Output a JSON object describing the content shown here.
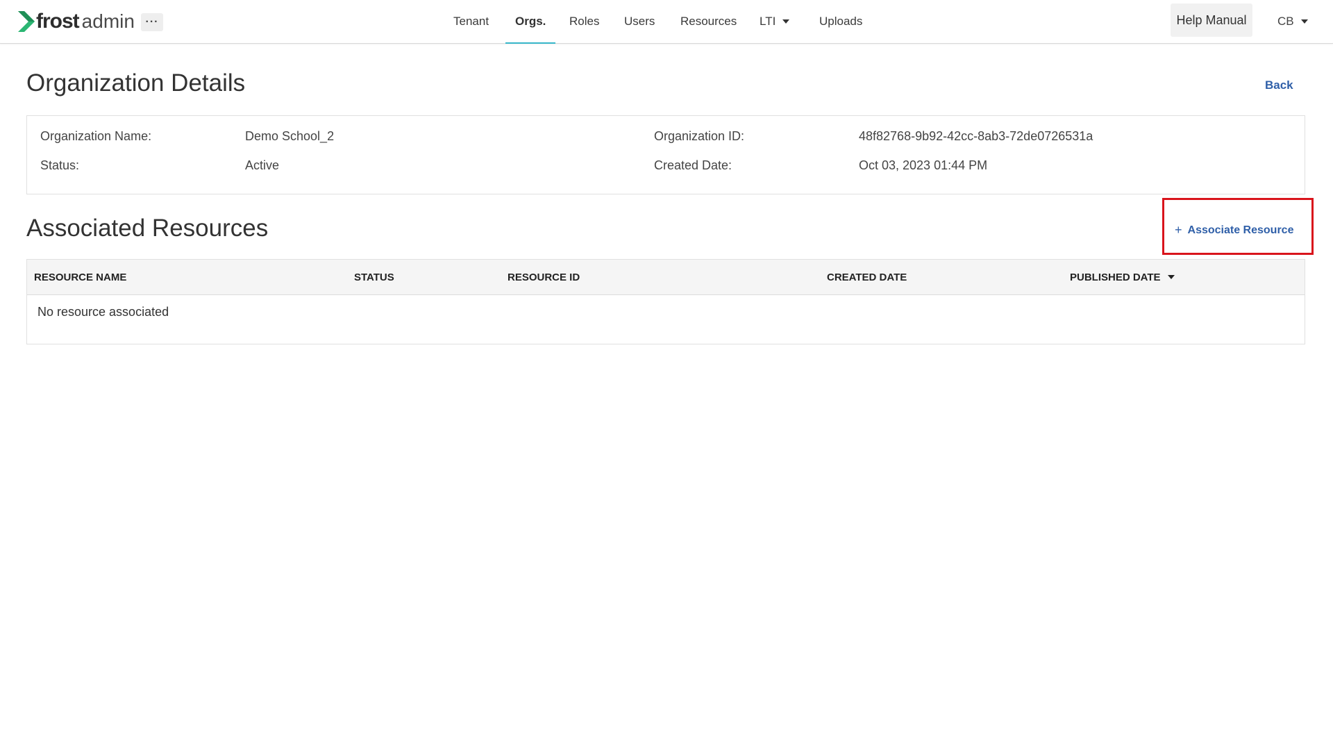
{
  "app": {
    "brand": "frost",
    "suffix": "admin",
    "more_label": "···"
  },
  "nav": {
    "items": [
      {
        "label": "Tenant"
      },
      {
        "label": "Orgs."
      },
      {
        "label": "Roles"
      },
      {
        "label": "Users"
      },
      {
        "label": "Resources"
      },
      {
        "label": "LTI"
      },
      {
        "label": "Uploads"
      }
    ],
    "active": "Orgs.",
    "help_label": "Help Manual",
    "user_initials": "CB"
  },
  "details": {
    "title": "Organization Details",
    "back_label": "Back",
    "fields": {
      "name_label": "Organization Name:",
      "name_value": "Demo School_2",
      "status_label": "Status:",
      "status_value": "Active",
      "id_label": "Organization ID:",
      "id_value": "48f82768-9b92-42cc-8ab3-72de0726531a",
      "created_label": "Created Date:",
      "created_value": "Oct 03, 2023 01:44 PM"
    }
  },
  "resources": {
    "title": "Associated Resources",
    "associate_label": "Associate Resource",
    "columns": [
      "RESOURCE NAME",
      "STATUS",
      "RESOURCE ID",
      "CREATED DATE",
      "PUBLISHED DATE"
    ],
    "sorted_column": "PUBLISHED DATE",
    "empty_message": "No resource associated"
  },
  "colors": {
    "accent": "#36b6c9",
    "link": "#2f5fa8",
    "highlight": "#d9141c",
    "logo_green": "#2bb673"
  },
  "icons": {
    "logo": "chevron-logo-icon",
    "more": "ellipsis-icon",
    "dropdown": "caret-down-icon",
    "add": "plus-icon"
  }
}
